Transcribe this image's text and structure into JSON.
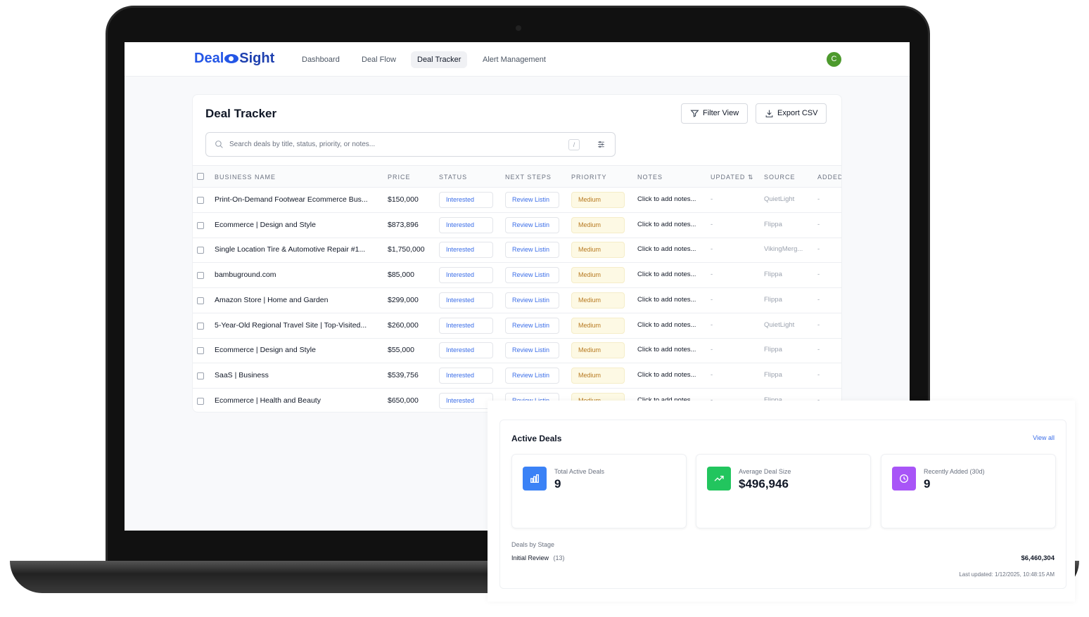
{
  "nav": {
    "logo_left": "Deal",
    "logo_right": "Sight",
    "items": [
      "Dashboard",
      "Deal Flow",
      "Deal Tracker",
      "Alert Management"
    ],
    "active": "Deal Tracker",
    "avatar": "C"
  },
  "tracker": {
    "title": "Deal Tracker",
    "filter_label": "Filter View",
    "export_label": "Export CSV",
    "search_placeholder": "Search deals by title, status, priority, or notes...",
    "shortcut": "/",
    "columns": [
      "BUSINESS NAME",
      "PRICE",
      "STATUS",
      "NEXT STEPS",
      "PRIORITY",
      "NOTES",
      "UPDATED ⇅",
      "SOURCE",
      "ADDED"
    ],
    "rows": [
      {
        "name": "Print-On-Demand Footwear Ecommerce Bus...",
        "price": "$150,000",
        "status": "Interested",
        "next": "Review Listin",
        "priority": "Medium",
        "notes": "Click to add notes...",
        "updated": "-",
        "source": "QuietLight",
        "added": "-"
      },
      {
        "name": "Ecommerce | Design and Style",
        "price": "$873,896",
        "status": "Interested",
        "next": "Review Listin",
        "priority": "Medium",
        "notes": "Click to add notes...",
        "updated": "-",
        "source": "Flippa",
        "added": "-"
      },
      {
        "name": "Single Location Tire & Automotive Repair #1...",
        "price": "$1,750,000",
        "status": "Interested",
        "next": "Review Listin",
        "priority": "Medium",
        "notes": "Click to add notes...",
        "updated": "-",
        "source": "VikingMerg...",
        "added": "-"
      },
      {
        "name": "bambuground.com",
        "price": "$85,000",
        "status": "Interested",
        "next": "Review Listin",
        "priority": "Medium",
        "notes": "Click to add notes...",
        "updated": "-",
        "source": "Flippa",
        "added": "-"
      },
      {
        "name": "Amazon Store | Home and Garden",
        "price": "$299,000",
        "status": "Interested",
        "next": "Review Listin",
        "priority": "Medium",
        "notes": "Click to add notes...",
        "updated": "-",
        "source": "Flippa",
        "added": "-"
      },
      {
        "name": "5-Year-Old Regional Travel Site | Top-Visited...",
        "price": "$260,000",
        "status": "Interested",
        "next": "Review Listin",
        "priority": "Medium",
        "notes": "Click to add notes...",
        "updated": "-",
        "source": "QuietLight",
        "added": "-"
      },
      {
        "name": "Ecommerce | Design and Style",
        "price": "$55,000",
        "status": "Interested",
        "next": "Review Listin",
        "priority": "Medium",
        "notes": "Click to add notes...",
        "updated": "-",
        "source": "Flippa",
        "added": "-"
      },
      {
        "name": "SaaS | Business",
        "price": "$539,756",
        "status": "Interested",
        "next": "Review Listin",
        "priority": "Medium",
        "notes": "Click to add notes...",
        "updated": "-",
        "source": "Flippa",
        "added": "-"
      },
      {
        "name": "Ecommerce | Health and Beauty",
        "price": "$650,000",
        "status": "Interested",
        "next": "Review Listin",
        "priority": "Medium",
        "notes": "Click to add notes...",
        "updated": "-",
        "source": "Flippa",
        "added": "-"
      }
    ]
  },
  "active_deals": {
    "title": "Active Deals",
    "view_all": "View all",
    "stats": [
      {
        "label": "Total Active Deals",
        "value": "9",
        "icon": "bar-chart-icon",
        "color": "#3b82f6"
      },
      {
        "label": "Average Deal Size",
        "value": "$496,946",
        "icon": "trending-up-icon",
        "color": "#22c55e"
      },
      {
        "label": "Recently Added (30d)",
        "value": "9",
        "icon": "clock-icon",
        "color": "#a855f7"
      }
    ],
    "stage_heading": "Deals by Stage",
    "stage_name": "Initial Review",
    "stage_count": "(13)",
    "stage_total": "$6,460,304",
    "last_updated": "Last updated: 1/12/2025, 10:48:15 AM"
  }
}
